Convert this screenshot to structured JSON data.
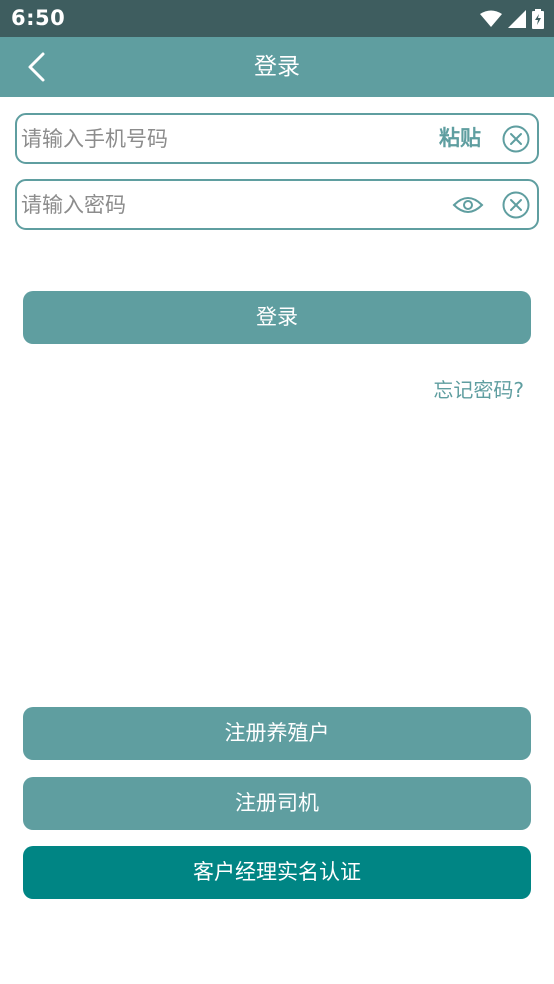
{
  "status_bar": {
    "time": "6:50",
    "icons": [
      "wifi-icon",
      "signal-icon",
      "battery-charging-icon"
    ]
  },
  "app_bar": {
    "title": "登录",
    "back_icon": "chevron-left-icon"
  },
  "phone_field": {
    "placeholder": "请输入手机号码",
    "value": "",
    "paste_label": "粘贴",
    "clear_icon": "clear-circle-icon"
  },
  "password_field": {
    "placeholder": "请输入密码",
    "value": "",
    "toggle_icon": "eye-icon",
    "clear_icon": "clear-circle-icon"
  },
  "login_button": {
    "label": "登录"
  },
  "forgot_password": {
    "label": "忘记密码?"
  },
  "register_farmer_button": {
    "label": "注册养殖户"
  },
  "register_driver_button": {
    "label": "注册司机"
  },
  "manager_verify_button": {
    "label": "客户经理实名认证"
  },
  "colors": {
    "primary": "#5f9ea0",
    "dark_primary": "#008584",
    "status_bar": "#3e5d5f"
  }
}
